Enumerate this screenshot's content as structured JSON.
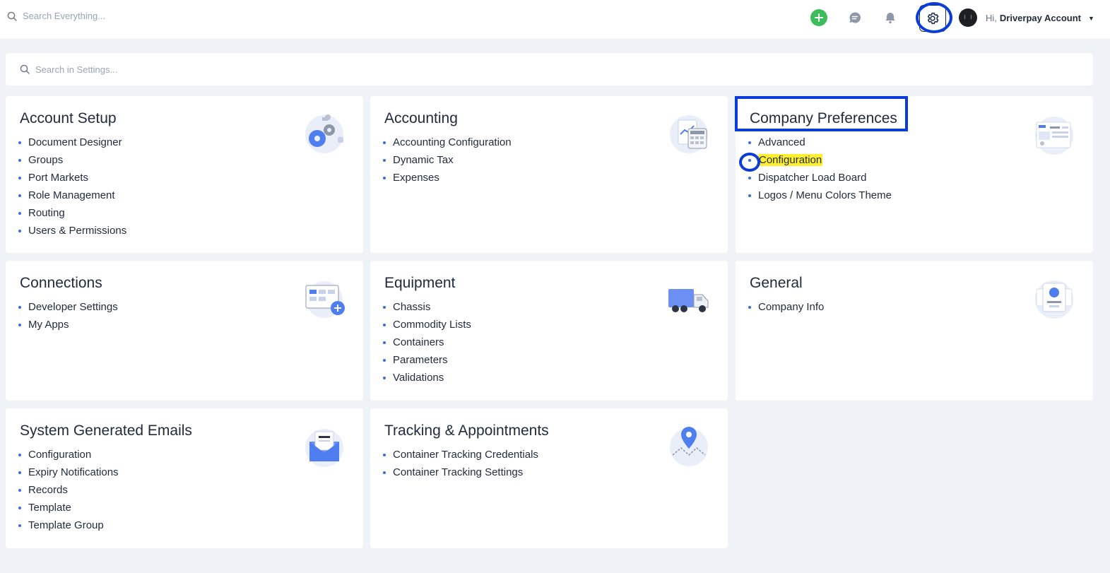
{
  "topbar": {
    "search_placeholder": "Search Everything...",
    "user_greeting": "Hi,",
    "user_name": "Driverpay Account",
    "icons": [
      "search-icon",
      "plus-icon",
      "chat-icon",
      "bell-icon",
      "gear-icon",
      "avatar",
      "caret-down-icon"
    ]
  },
  "settings_search": {
    "placeholder": "Search in Settings..."
  },
  "cards": {
    "account_setup": {
      "title": "Account Setup",
      "items": [
        "Document Designer",
        "Groups",
        "Port Markets",
        "Role Management",
        "Routing",
        "Users & Permissions"
      ]
    },
    "accounting": {
      "title": "Accounting",
      "items": [
        "Accounting Configuration",
        "Dynamic Tax",
        "Expenses"
      ]
    },
    "company_preferences": {
      "title": "Company Preferences",
      "items": [
        "Advanced",
        "Configuration",
        "Dispatcher Load Board",
        "Logos / Menu Colors Theme"
      ]
    },
    "connections": {
      "title": "Connections",
      "items": [
        "Developer Settings",
        "My Apps"
      ]
    },
    "equipment": {
      "title": "Equipment",
      "items": [
        "Chassis",
        "Commodity Lists",
        "Containers",
        "Parameters",
        "Validations"
      ]
    },
    "general": {
      "title": "General",
      "items": [
        "Company Info"
      ]
    },
    "system_emails": {
      "title": "System Generated Emails",
      "items": [
        "Configuration",
        "Expiry Notifications",
        "Records",
        "Template",
        "Template Group"
      ]
    },
    "tracking": {
      "title": "Tracking & Appointments",
      "items": [
        "Container Tracking Credentials",
        "Container Tracking Settings"
      ]
    }
  },
  "colors": {
    "accent": "#3a6ce0",
    "annotation": "#0b3bd8",
    "highlight": "#ffef2e",
    "add_button": "#3dbc5c",
    "page_bg": "#eff2f7"
  }
}
